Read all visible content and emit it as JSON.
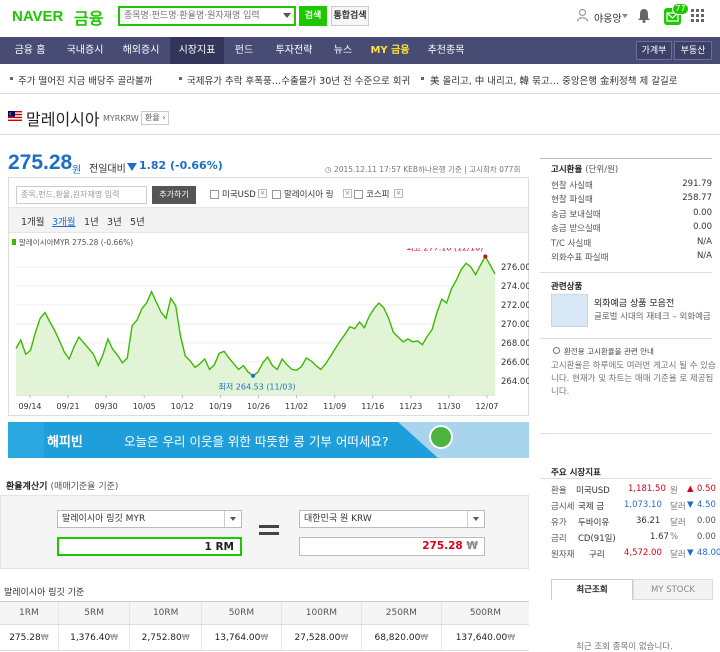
{
  "header": {
    "logo_brand": "NAVER",
    "logo_section": "금융",
    "search_placeholder": "종목명·펀드명·환율명·원자재명 입력",
    "search_button": "검색",
    "total_search_button": "통합검색",
    "user_name": "야옹앙",
    "mail_count": "77"
  },
  "nav": {
    "items": [
      "금융 홈",
      "국내증시",
      "해외증시",
      "시장지표",
      "펀드",
      "투자전략",
      "뉴스",
      "MY 금융",
      "추천종목"
    ],
    "right_items": [
      "가계부",
      "부동산"
    ]
  },
  "ticker": [
    "주가 떨어진 지금 배당주 골라볼까",
    "국제유가 추락 후폭풍…수출물가 30년 전 수준으로 회귀",
    "美 올리고, 中 내리고, 韓 묶고… 중앙은행 金利정책 제 갈길로"
  ],
  "title": {
    "name": "말레이시아",
    "code": "MYRKRW",
    "tag": "환율"
  },
  "price": {
    "value": "275.28",
    "unit": "원",
    "label": "전일대비",
    "change": "1.82 (-0.66%)",
    "meta": "2015.12.11 17:57 KEB하나은행 기준 | 고시회차 077회"
  },
  "chart_controls": {
    "search_placeholder": "종목,펀드,환율,원자재명 입력",
    "add_button": "추가하기",
    "compare": [
      "미국USD",
      "말레이시아 링",
      "코스피"
    ],
    "periods": [
      "1개월",
      "3개월",
      "1년",
      "3년",
      "5년"
    ],
    "active_period": "3개월"
  },
  "chart_data": {
    "type": "line",
    "legend": "말레이시아MYR 275.28 (-0.66%)",
    "x_ticks": [
      "09/14",
      "09/21",
      "09/30",
      "10/05",
      "10/12",
      "10/19",
      "10/26",
      "11/02",
      "11/09",
      "11/16",
      "11/23",
      "11/30",
      "12/07"
    ],
    "y_ticks": [
      264,
      266,
      268,
      270,
      272,
      274,
      276
    ],
    "ylim": [
      262.5,
      278
    ],
    "max_label": "최고",
    "max_value": "277.10",
    "max_date": "(12/10)",
    "min_label": "최저",
    "min_value": "264.53",
    "min_date": "(11/03)",
    "values": [
      267.4,
      268.3,
      266.8,
      267.2,
      269.1,
      270.6,
      271.2,
      270.2,
      269.3,
      268.2,
      267.0,
      266.3,
      267.6,
      268.6,
      268.0,
      267.4,
      266.8,
      265.6,
      266.8,
      268.4,
      267.3,
      266.7,
      265.9,
      266.4,
      269.8,
      270.4,
      271.6,
      272.2,
      273.4,
      272.3,
      271.2,
      270.6,
      272.7,
      271.9,
      268.7,
      266.6,
      266.1,
      265.4,
      265.8,
      266.3,
      265.2,
      265.7,
      266.9,
      267.1,
      266.4,
      265.8,
      265.2,
      265.6,
      264.9,
      264.53,
      264.9,
      265.9,
      266.5,
      265.6,
      265.2,
      266.3,
      265.7,
      265.2,
      265.1,
      265.5,
      266.4,
      266.1,
      265.6,
      265.2,
      265.8,
      266.6,
      267.4,
      268.2,
      268.9,
      269.7,
      269.5,
      270.2,
      269.6,
      270.8,
      271.6,
      272.2,
      271.7,
      270.6,
      269.1,
      268.6,
      268.1,
      268.4,
      268.1,
      268.2,
      267.8,
      268.7,
      269.4,
      271.2,
      272.6,
      272.2,
      273.7,
      274.6,
      275.7,
      276.4,
      276.0,
      275.2,
      276.2,
      277.1,
      276.2,
      275.28
    ],
    "series_color": "#3cb900"
  },
  "banner": {
    "brand": "해피빈",
    "text": "오늘은 우리 이웃을 위한 따뜻한 콩 기부 어떠세요?"
  },
  "calculator": {
    "title": "환율계산기",
    "subtitle": "(매매기준율 기준)",
    "from_select": "말레이시아 링깃 MYR",
    "to_select": "대한민국 원 KRW",
    "from_value": "1",
    "from_unit": "RM",
    "to_value": "275.28",
    "to_unit": "₩"
  },
  "rate_table": {
    "title": "말레이시아 링깃 기준",
    "headers": [
      "1RM",
      "5RM",
      "10RM",
      "50RM",
      "100RM",
      "250RM",
      "500RM"
    ],
    "values": [
      "275.28",
      "1,376.40",
      "2,752.80",
      "13,764.00",
      "27,528.00",
      "68,820.00",
      "137,640.00"
    ],
    "unit": "₩"
  },
  "notice_rates": {
    "title": "고시환율",
    "unit": "(단위/원)",
    "rows": [
      {
        "label": "현찰 사실때",
        "value": "291.79"
      },
      {
        "label": "현찰 파실때",
        "value": "258.77"
      },
      {
        "label": "송금 보내실때",
        "value": "0.00"
      },
      {
        "label": "송금 받으실때",
        "value": "0.00"
      },
      {
        "label": "T/C 사실때",
        "value": "N/A"
      },
      {
        "label": "외화수표 파실때",
        "value": "N/A"
      }
    ]
  },
  "related": {
    "title": "관련상품",
    "ad_title": "외화예금 상품 모음전",
    "ad_sub": "글로벌 시대의 재테크 – 외화예금",
    "info_title": "환전용 고시환율을 관련 안내",
    "info_text": "고시환율은 하루에도 여러번 게고시 될 수 있습니다. 현재가 및 차트는 매매 기준율 로 제공됩니다."
  },
  "market": {
    "title": "주요 시장지표",
    "rows": [
      {
        "cat": "환율",
        "name": "미국USD",
        "value": "1,181.50",
        "unit": "원",
        "dir": "up",
        "chg": "0.50"
      },
      {
        "cat": "금시세",
        "name": "국제 금",
        "value": "1,073.10",
        "unit": "달러",
        "dir": "down",
        "chg": "4.50"
      },
      {
        "cat": "유가",
        "name": "두바이유",
        "value": "36.21",
        "unit": "달러",
        "dir": "none",
        "chg": "0.00"
      },
      {
        "cat": "금리",
        "name": "CD(91일)",
        "value": "1.67",
        "unit": "%",
        "dir": "none",
        "chg": "0.00"
      },
      {
        "cat": "원자재",
        "name": "구리",
        "value": "4,572.00",
        "unit": "달러",
        "dir": "down",
        "chg": "48.00"
      }
    ]
  },
  "recent_tabs": [
    "최근조회",
    "MY STOCK"
  ],
  "recent_empty": "최근 조회 종목이 없습니다."
}
